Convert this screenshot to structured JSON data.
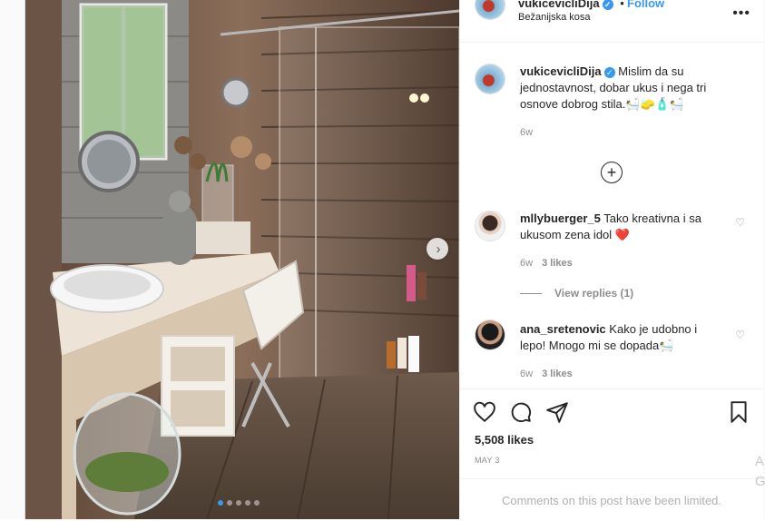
{
  "owner": {
    "username": "vukicevicliDija",
    "follow_label": "Follow",
    "location": "Bežanijska kosa",
    "verified_glyph": "✓",
    "separator": "•"
  },
  "caption": {
    "username": "vukicevicliDija",
    "text": "Mislim da su jednostavnost, dobar ukus i nega tri osnove dobrog stila.🛀🧽🧴🛀",
    "time": "6w"
  },
  "load_more_icon": "+",
  "comments": [
    {
      "username": "mllybuerger_5",
      "text": "Tako kreativna i sa ukusom zena idol ❤️",
      "time": "6w",
      "likes": "3 likes",
      "view_replies": "View replies (1)"
    },
    {
      "username": "ana_sretenovic",
      "text": "Kako je udobno i lepo! Mnogo mi se dopada🛀",
      "time": "6w",
      "likes": "3 likes"
    }
  ],
  "post": {
    "likes": "5,508 likes",
    "date": "MAY 3",
    "comments_limited": "Comments on this post have been limited."
  },
  "carousel": {
    "next_glyph": "›",
    "dots": 5,
    "active_dot": 0
  },
  "side_letters": [
    "A",
    "G"
  ],
  "colors": {
    "accent": "#3897f0",
    "heart": "#ed4956",
    "muted": "#8e8e8e"
  },
  "icons": [
    "heart-icon",
    "comment-icon",
    "share-icon",
    "bookmark-icon",
    "more-icon",
    "verified-icon",
    "plus-circle-icon",
    "chevron-right-icon"
  ]
}
